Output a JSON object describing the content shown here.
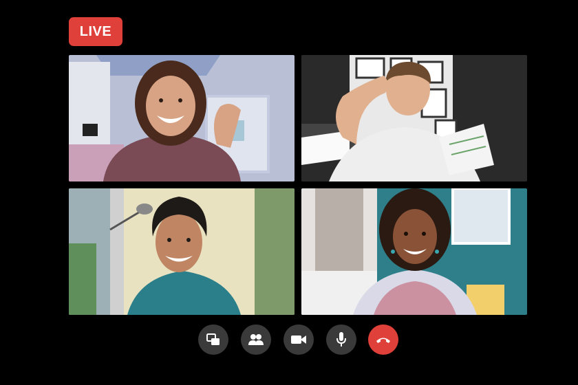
{
  "live_badge": {
    "label": "LIVE",
    "color": "#e0403a"
  },
  "participants": [
    {
      "tile": "top-left",
      "description_colors": {
        "wall": "#b7bfd4",
        "shirt": "#7a4a55",
        "hair": "#4a2a1c",
        "skin": "#d8a384"
      }
    },
    {
      "tile": "top-right",
      "description_colors": {
        "wall": "#2a2a2a",
        "shirt": "#eeeeee",
        "hair": "#6b4a30",
        "skin": "#e0b08f"
      }
    },
    {
      "tile": "bottom-left",
      "description_colors": {
        "wall": "#e8e2c0",
        "shirt": "#2a7f8a",
        "hair": "#1e1a18",
        "skin": "#c08563"
      }
    },
    {
      "tile": "bottom-right",
      "description_colors": {
        "wall": "#2f7f8a",
        "shirt": "#d9d9e8",
        "hair": "#2a1a12",
        "skin": "#8a5236"
      }
    }
  ],
  "controls": {
    "button_color": "#3a3a3a",
    "end_call_color": "#e0403a",
    "icons": [
      "screen-share-icon",
      "participants-icon",
      "video-camera-icon",
      "microphone-icon",
      "end-call-icon"
    ]
  }
}
